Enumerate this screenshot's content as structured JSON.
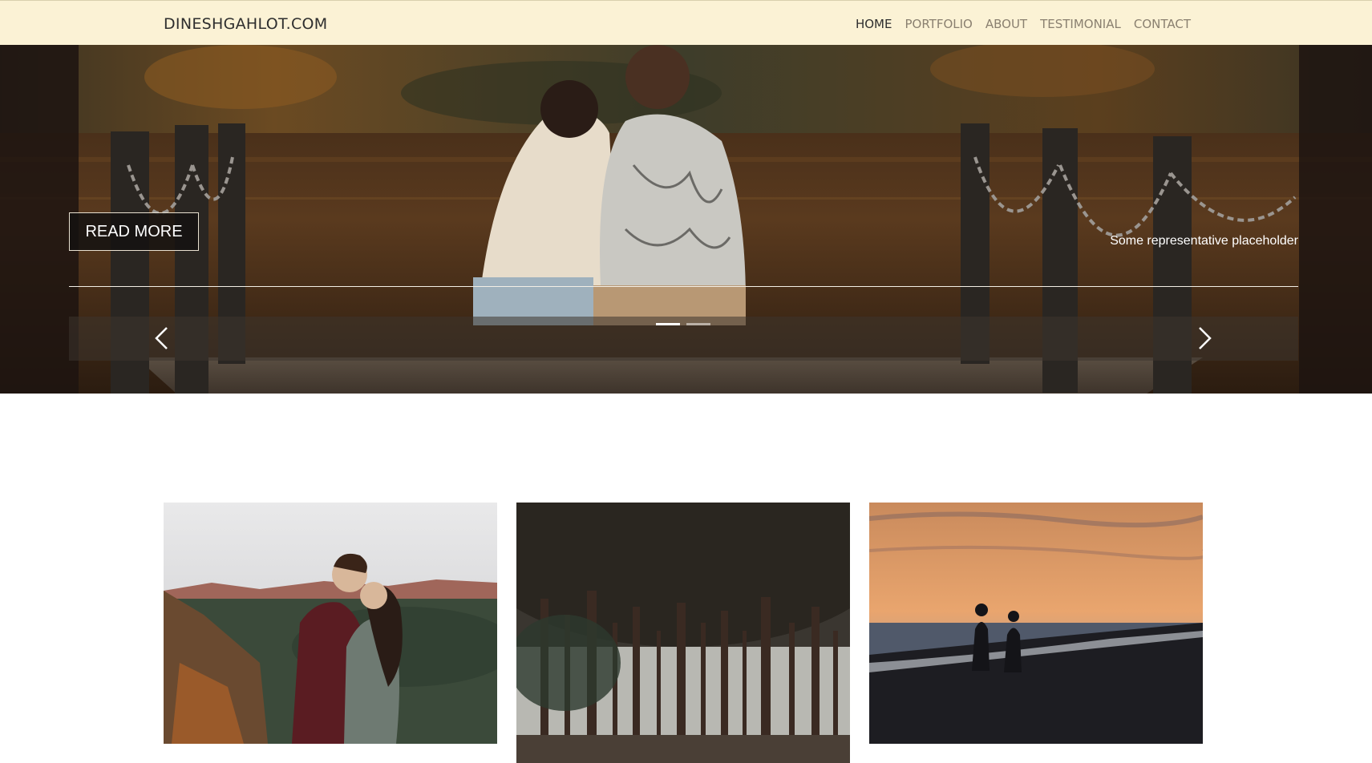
{
  "navbar": {
    "brand": "DINESHGAHLOT.COM",
    "links": [
      {
        "label": "HOME",
        "active": true
      },
      {
        "label": "PORTFOLIO",
        "active": false
      },
      {
        "label": "ABOUT",
        "active": false
      },
      {
        "label": "TESTIMONIAL",
        "active": false
      },
      {
        "label": "CONTACT",
        "active": false
      }
    ]
  },
  "hero": {
    "button_label": "READ MORE",
    "caption": "Some representative placeholder",
    "indicators": {
      "count": 2,
      "active_index": 0
    },
    "prev_icon": "chevron-left-icon",
    "next_icon": "chevron-right-icon"
  },
  "gallery": {
    "items": [
      {
        "scene": "couple-kissing-canyon"
      },
      {
        "scene": "pine-forest"
      },
      {
        "scene": "couple-walking-beach-sunset"
      }
    ]
  },
  "colors": {
    "navbar_bg": "#fbf2d5",
    "brand_text": "#2e2e2e",
    "nav_text": "#8a8070"
  }
}
